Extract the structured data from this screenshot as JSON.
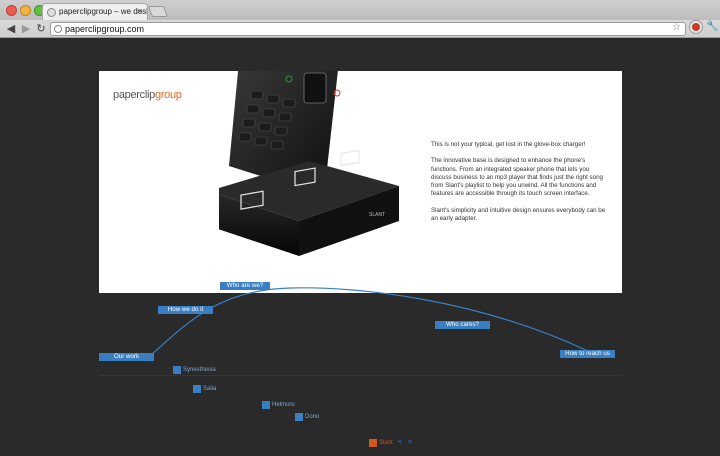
{
  "browser": {
    "tab_title": "paperclipgroup – we design",
    "url": "paperclipgroup.com"
  },
  "page": {
    "logo_main": "paperclip",
    "logo_accent": "group",
    "brand_color": "#e86a1f",
    "accent_color": "#3a7fc2",
    "paragraphs": [
      "This is not your typical, get lost in the glove-box charger!",
      "The innovative base is designed to enhance the phone's functions. From an integrated speaker phone that lets you discuss business to an mp3 player that finds just the right song from Slant's playlist to help you unwind. All the functions and features are accessible through its touch screen interface.",
      "Slant's simplicity and intuitive design ensures everybody can be an early adapter."
    ],
    "device_label": "SLANT"
  },
  "timeline": {
    "our_work": "Our work",
    "how_we_do_it": "How we do it",
    "who_are_we": "Who are we?",
    "who_cares": "Who cares?",
    "how_to_reach_us": "How to reach us"
  },
  "projects": [
    "Synesthesia",
    "Salia",
    "Helmoro",
    "Dono"
  ],
  "pager": {
    "current": "Slant",
    "prev": "<",
    "next": ">"
  }
}
